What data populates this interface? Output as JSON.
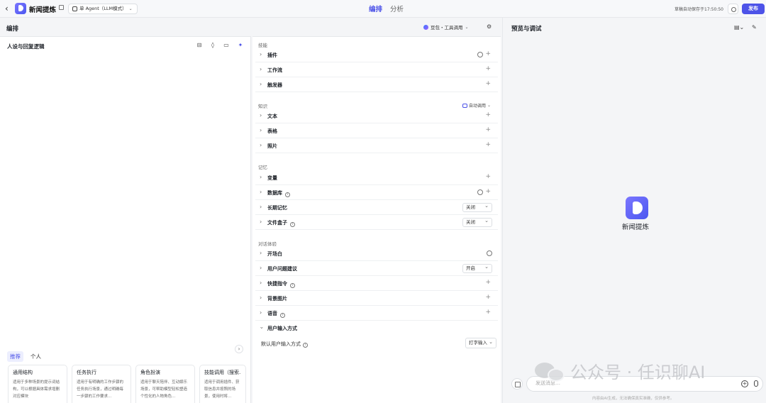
{
  "header": {
    "app_title": "新闻提炼",
    "mode_label": "单 Agent（LLM模式）",
    "tabs": [
      {
        "label": "编排",
        "active": true
      },
      {
        "label": "分析",
        "active": false
      }
    ],
    "save_status": "草稿自动保存于17:50:50",
    "publish_label": "发布"
  },
  "edit": {
    "section_title": "编排",
    "model_label": "豆包・工具调用"
  },
  "persona": {
    "title": "人设与回复逻辑",
    "rec_tabs": [
      "推荐",
      "个人"
    ],
    "cards": [
      {
        "title": "通用结构",
        "desc": "适用于多种场景的提示词结构，可以根据具体需求增删对应模块"
      },
      {
        "title": "任务执行",
        "desc": "适用于有明确的工作步骤的任务执行场景，通过明确每一步骤的工作要求…"
      },
      {
        "title": "角色扮演",
        "desc": "适用于聊天陪伴、互动娱乐场景，可帮助模型轻松塑造个性化的人物角色…"
      },
      {
        "title": "技能调用（搜索…",
        "desc": "适用于调用插件、获取信息并按照的场景，使用时将…"
      }
    ]
  },
  "skills": {
    "group_skill": "技能",
    "plugin": "插件",
    "workflow": "工作流",
    "trigger": "触发器",
    "group_knowledge": "知识",
    "auto_call": "自动调用",
    "text": "文本",
    "table": "表格",
    "photo": "照片",
    "group_memory": "记忆",
    "variable": "变量",
    "database": "数据库",
    "long_memory": "长期记忆",
    "long_memory_value": "关闭",
    "file_box": "文件盒子",
    "file_box_value": "关闭",
    "group_dialog": "对话体验",
    "opening": "开场白",
    "suggestion": "用户问题建议",
    "suggestion_value": "开启",
    "shortcut": "快捷指令",
    "background": "背景图片",
    "voice": "语音",
    "user_input": "用户输入方式",
    "default_input_label": "默认用户输入方式",
    "default_input_value": "打字输入"
  },
  "preview": {
    "title": "预览与调试",
    "bot_name": "新闻提炼",
    "input_placeholder": "发送消息…",
    "disclaimer": "内容由AI生成，无法确保真实准确，仅供参考。"
  },
  "watermark": {
    "text": "公众号 · 任识聊AI"
  }
}
